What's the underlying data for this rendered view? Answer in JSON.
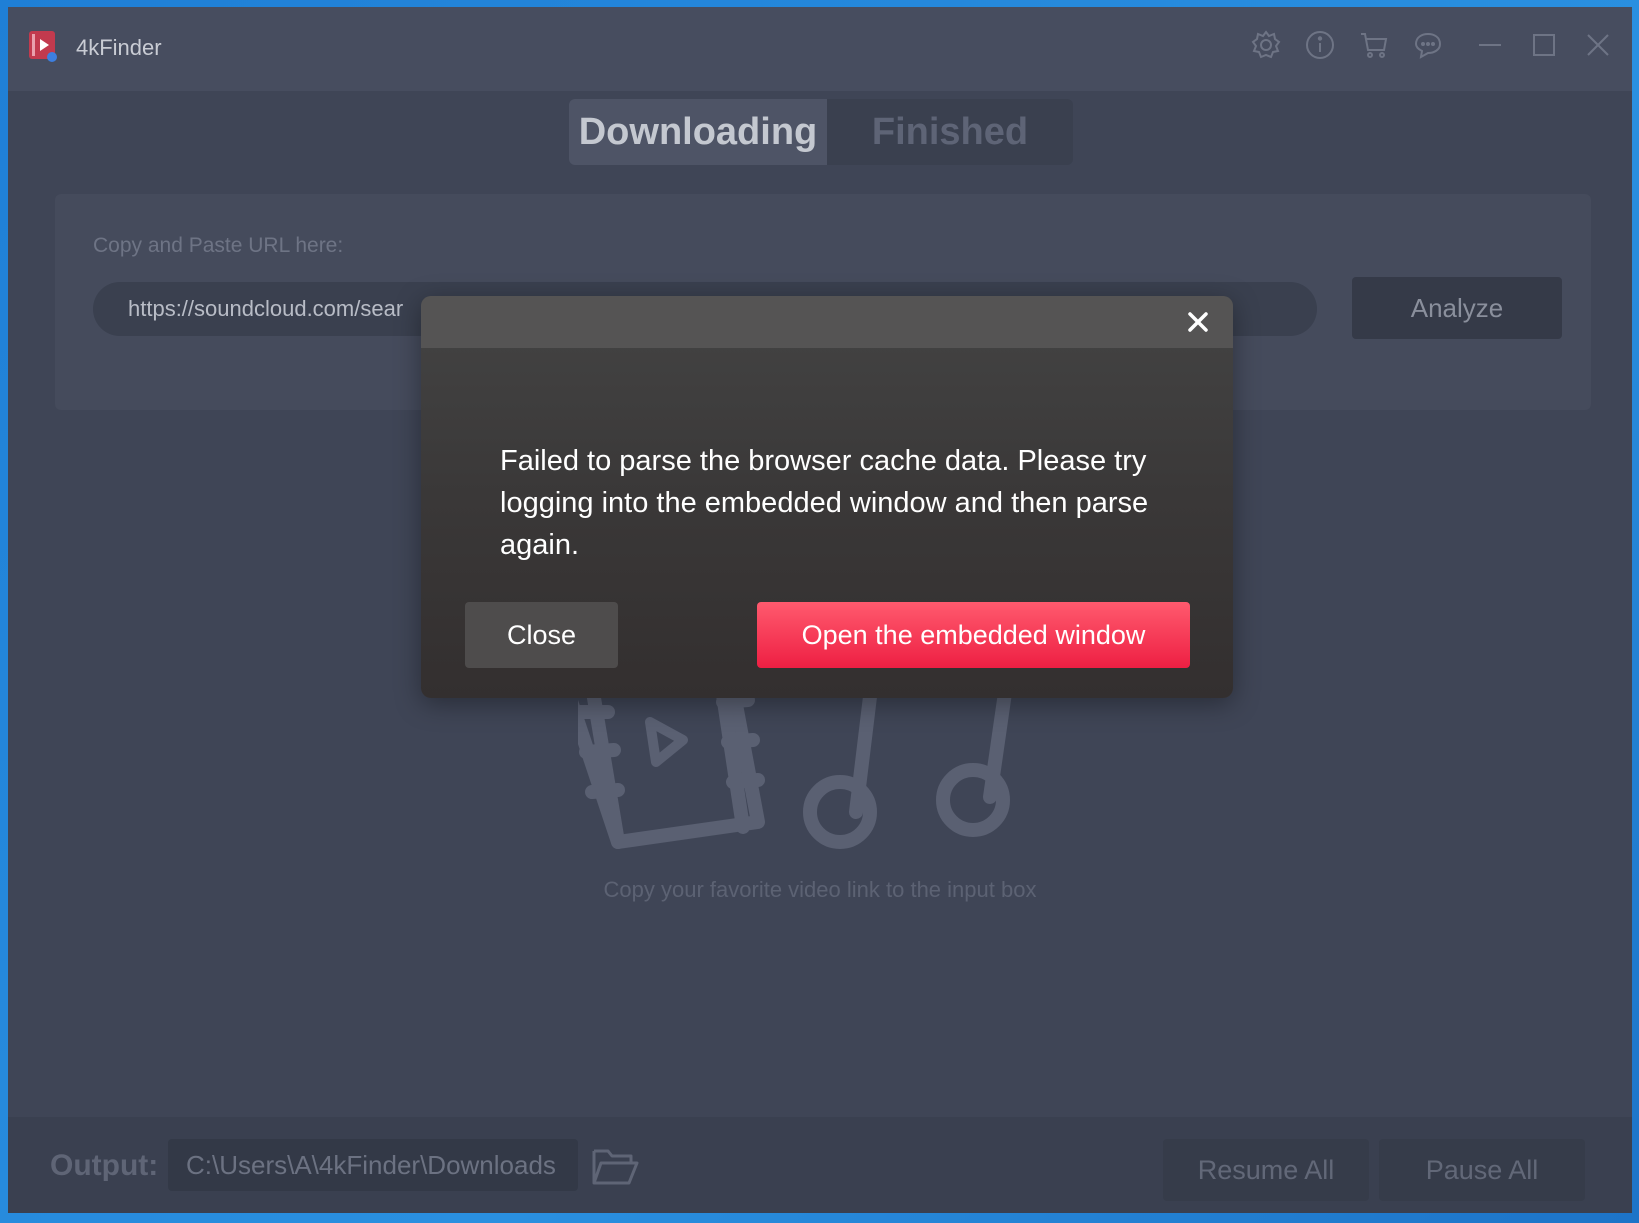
{
  "app": {
    "title": "4kFinder"
  },
  "titlebar": {
    "icons": [
      "gear-icon",
      "info-icon",
      "cart-icon",
      "chat-icon"
    ],
    "window_controls": [
      "minimize-icon",
      "maximize-icon",
      "close-icon"
    ]
  },
  "tabs": [
    {
      "label": "Downloading",
      "active": true
    },
    {
      "label": "Finished",
      "active": false
    }
  ],
  "url_panel": {
    "label": "Copy and Paste URL here:",
    "input_value": "https://soundcloud.com/sear",
    "analyze_label": "Analyze"
  },
  "empty_state": {
    "hint": "Copy your favorite video link to the input box"
  },
  "footer": {
    "output_label": "Output:",
    "output_path": "C:\\Users\\A\\4kFinder\\Downloads",
    "resume_label": "Resume All",
    "pause_label": "Pause All"
  },
  "dialog": {
    "message": "Failed to parse the browser cache data. Please try logging into the embedded window and then parse again.",
    "close_label": "Close",
    "open_label": "Open the embedded window",
    "accent_color": "#ee1f43"
  }
}
